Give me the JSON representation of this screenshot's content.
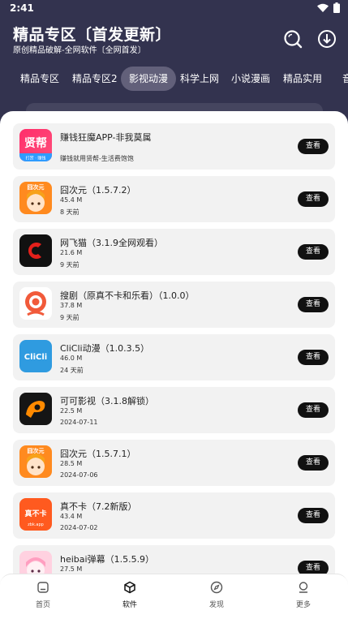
{
  "status_bar": {
    "time": "2:41"
  },
  "header": {
    "title": "精品专区〔首发更新〕",
    "subtitle": "原创精品破解-全网软件〔全网首发〕"
  },
  "tabs": [
    {
      "label": "精品专区",
      "active": false
    },
    {
      "label": "精品专区2",
      "active": false
    },
    {
      "label": "影视动漫",
      "active": true
    },
    {
      "label": "科学上网",
      "active": false
    },
    {
      "label": "小说漫画",
      "active": false
    },
    {
      "label": "精品实用",
      "active": false
    },
    {
      "label": "音",
      "active": false
    }
  ],
  "items": [
    {
      "name": "赚钱狂魔APP-非我莫属",
      "line1": "",
      "line2": "赚钱就用贤帮-生活费饱饱",
      "button": "查看",
      "icon": "xianbang-app-icon"
    },
    {
      "name": "囧次元（1.5.7.2）",
      "line1": "45.4 M",
      "line2": "8 天前",
      "button": "查看",
      "icon": "jiongciyuan-app-icon"
    },
    {
      "name": "网飞猫（3.1.9全网观看）",
      "line1": "21.6 M",
      "line2": "9 天前",
      "button": "查看",
      "icon": "wangfeimao-app-icon"
    },
    {
      "name": "搜剧（原真不卡和乐看）（1.0.0）",
      "line1": "37.8 M",
      "line2": "9 天前",
      "button": "查看",
      "icon": "souju-app-icon"
    },
    {
      "name": "CliCli动漫（1.0.3.5）",
      "line1": "46.0 M",
      "line2": "24 天前",
      "button": "查看",
      "icon": "clicli-app-icon"
    },
    {
      "name": "可可影视（3.1.8解锁）",
      "line1": "22.5 M",
      "line2": "2024-07-11",
      "button": "查看",
      "icon": "keke-app-icon"
    },
    {
      "name": "囧次元（1.5.7.1）",
      "line1": "28.5 M",
      "line2": "2024-07-06",
      "button": "查看",
      "icon": "jiongciyuan-app-icon"
    },
    {
      "name": "真不卡（7.2新版）",
      "line1": "43.4 M",
      "line2": "2024-07-02",
      "button": "查看",
      "icon": "zhenbuka-app-icon"
    },
    {
      "name": "heibai弹幕（1.5.5.9）",
      "line1": "27.5 M",
      "line2": "",
      "button": "查看",
      "icon": "heibai-app-icon"
    }
  ],
  "icon_text": {
    "jiong": "囧次元",
    "clicli": "CliCli",
    "zbk": "真不卡",
    "zbk_url": "zbk.app",
    "bang": "贤帮",
    "bang_tag": "打赏 · 赚钱"
  },
  "bottom_nav": [
    {
      "label": "首页",
      "icon": "home-icon",
      "active": false
    },
    {
      "label": "软件",
      "icon": "cube-icon",
      "active": true
    },
    {
      "label": "发现",
      "icon": "compass-icon",
      "active": false
    },
    {
      "label": "更多",
      "icon": "user-icon",
      "active": false
    }
  ],
  "colors": {
    "header_bg": "#33334f",
    "tab_active_bg": "#62607a",
    "button_bg": "#111111"
  }
}
